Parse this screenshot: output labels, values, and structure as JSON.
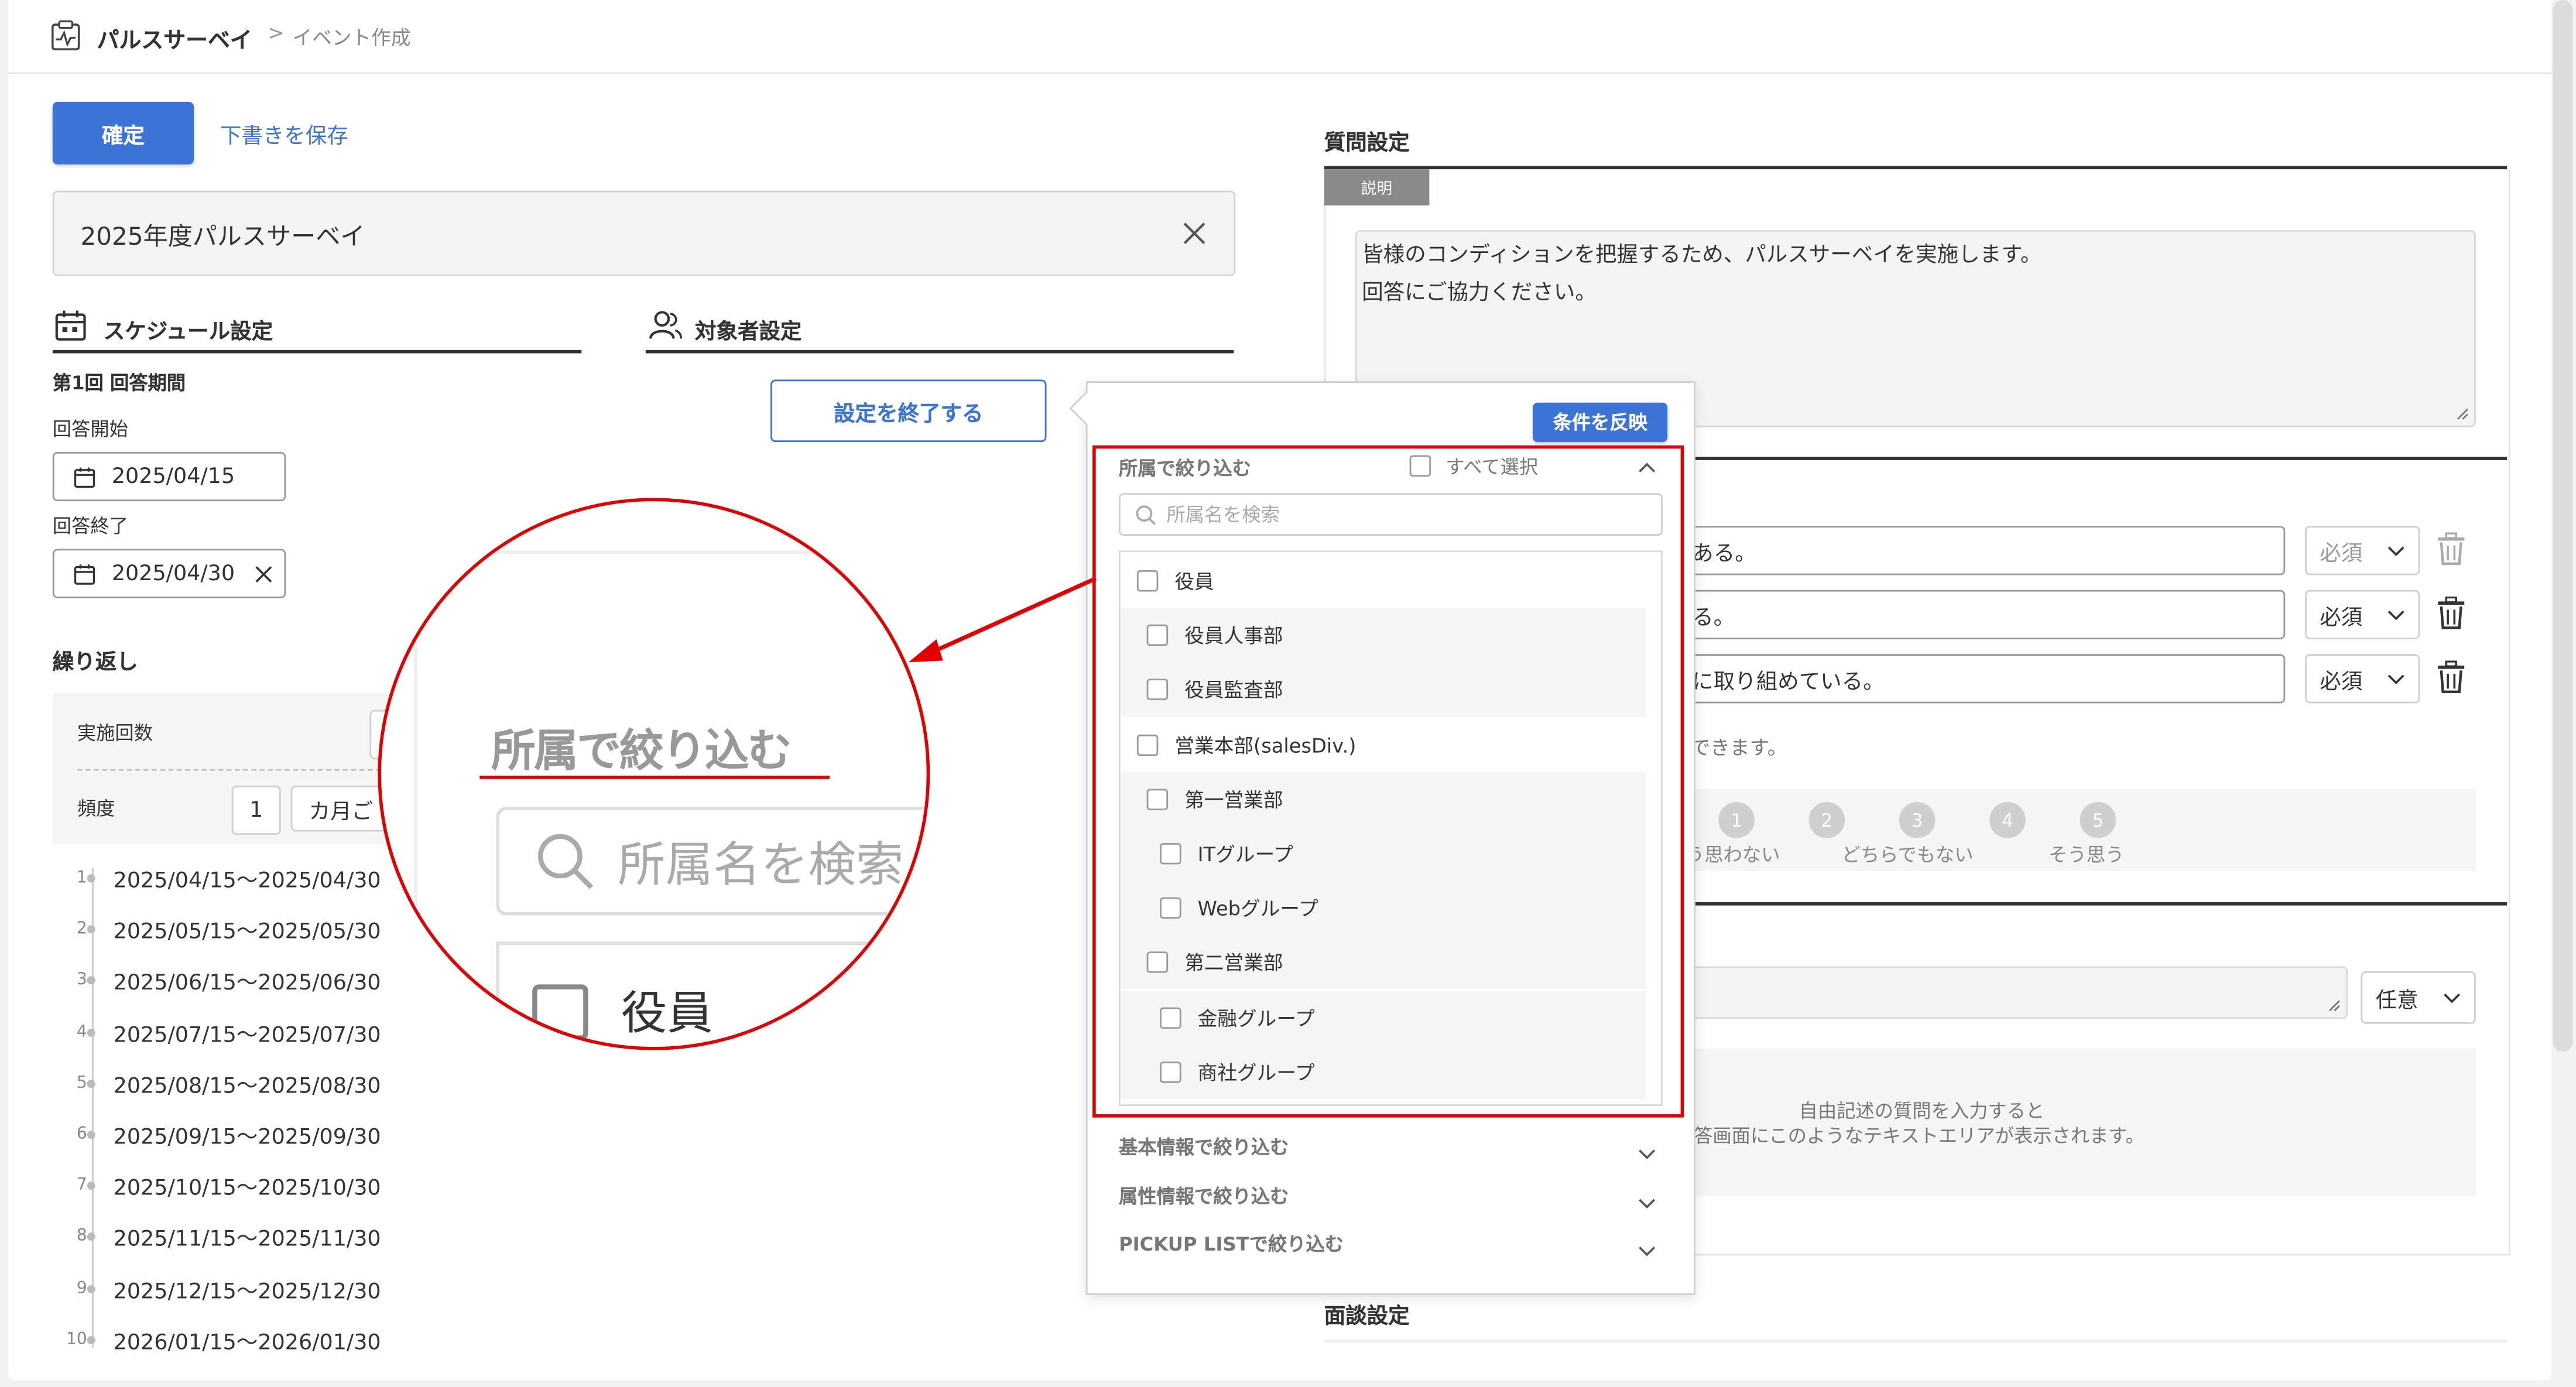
{
  "header": {
    "app_name": "パルスサーベイ",
    "separator": ">",
    "page": "イベント作成"
  },
  "toolbar": {
    "confirm_label": "確定",
    "draft_label": "下書きを保存"
  },
  "title_field": {
    "value": "2025年度パルスサーベイ"
  },
  "schedule": {
    "title": "スケジュール設定",
    "period_label": "第1回 回答期間",
    "start_label": "回答開始",
    "start_value": "2025/04/15",
    "end_label": "回答終了",
    "end_value": "2025/04/30",
    "repeat_label": "繰り返し",
    "count_label": "実施回数",
    "freq_label": "頻度",
    "freq_value": "1",
    "freq_unit": "カ月ご",
    "rows": [
      {
        "n": "1",
        "range": "2025/04/15～2025/04/30"
      },
      {
        "n": "2",
        "range": "2025/05/15～2025/05/30"
      },
      {
        "n": "3",
        "range": "2025/06/15～2025/06/30"
      },
      {
        "n": "4",
        "range": "2025/07/15～2025/07/30"
      },
      {
        "n": "5",
        "range": "2025/08/15～2025/08/30"
      },
      {
        "n": "6",
        "range": "2025/09/15～2025/09/30"
      },
      {
        "n": "7",
        "range": "2025/10/15～2025/10/30"
      },
      {
        "n": "8",
        "range": "2025/11/15～2025/11/30"
      },
      {
        "n": "9",
        "range": "2025/12/15～2025/12/30"
      },
      {
        "n": "10",
        "range": "2026/01/15～2026/01/30"
      }
    ]
  },
  "target": {
    "title": "対象者設定",
    "end_button": "設定を終了する"
  },
  "filter_panel": {
    "apply_label": "条件を反映",
    "section_title": "所属で絞り込む",
    "select_all": "すべて選択",
    "search_placeholder": "所属名を検索",
    "tree": [
      {
        "label": "役員",
        "level": 0,
        "shaded": false
      },
      {
        "label": "役員人事部",
        "level": 1,
        "shaded": true
      },
      {
        "label": "役員監査部",
        "level": 1,
        "shaded": true
      },
      {
        "label": "営業本部(salesDiv.)",
        "level": 0,
        "shaded": false
      },
      {
        "label": "第一営業部",
        "level": 1,
        "shaded": true
      },
      {
        "label": "ITグループ",
        "level": 2,
        "shaded": true
      },
      {
        "label": "Webグループ",
        "level": 2,
        "shaded": true
      },
      {
        "label": "第二営業部",
        "level": 1,
        "shaded": true
      },
      {
        "label": "金融グループ",
        "level": 2,
        "shaded": true
      },
      {
        "label": "商社グループ",
        "level": 2,
        "shaded": true
      }
    ],
    "collapsed": [
      {
        "label": "基本情報で絞り込む"
      },
      {
        "label": "属性情報で絞り込む"
      },
      {
        "label": "PICKUP LISTで絞り込む"
      }
    ]
  },
  "zoom": {
    "title": "所属で絞り込む",
    "search": "所属名を検索",
    "item": "役員"
  },
  "questions": {
    "title": "質問設定",
    "tab_label": "説明",
    "description_line1": "皆様のコンディションを把握するため、パルスサーベイを実施します。",
    "description_line2": "回答にご協力ください。",
    "items": [
      {
        "text": "ある。",
        "req": "必須"
      },
      {
        "text": "る。",
        "req": "必須"
      },
      {
        "text": "に取り組めている。",
        "req": "必須"
      }
    ],
    "note": "できます。",
    "scale": [
      {
        "n": "1",
        "label": "う思わない"
      },
      {
        "n": "2",
        "label": ""
      },
      {
        "n": "3",
        "label": "どちらでもない"
      },
      {
        "n": "4",
        "label": ""
      },
      {
        "n": "5",
        "label": "そう思う"
      }
    ],
    "free_req": "任意",
    "free_hint1": "自由記述の質問を入力すると",
    "free_hint2": "答画面にこのようなテキストエリアが表示されます。"
  },
  "interview": {
    "title": "面談設定"
  },
  "colors": {
    "accent": "#3b73d6",
    "highlight": "#e00000"
  }
}
